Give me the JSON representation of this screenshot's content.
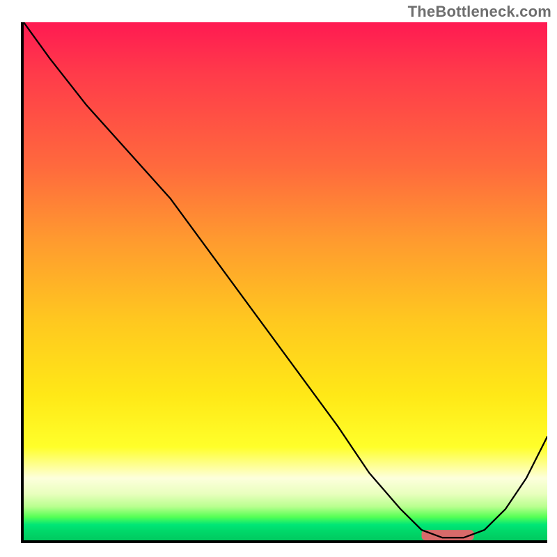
{
  "attribution": "TheBottleneck.com",
  "colors": {
    "gradient_top": "#ff1a52",
    "gradient_mid1": "#ff9a2f",
    "gradient_mid2": "#ffe817",
    "gradient_bottom": "#00c95f",
    "axis": "#000000",
    "curve": "#000000",
    "marker": "#d86a6a"
  },
  "chart_data": {
    "type": "line",
    "title": "",
    "xlabel": "",
    "ylabel": "",
    "xlim": [
      0,
      100
    ],
    "ylim": [
      0,
      100
    ],
    "grid": false,
    "series": [
      {
        "name": "curve",
        "x": [
          0,
          5,
          12,
          20,
          28,
          36,
          44,
          52,
          60,
          66,
          72,
          76,
          80,
          84,
          88,
          92,
          96,
          100
        ],
        "y": [
          100,
          93,
          84,
          75,
          66,
          55,
          44,
          33,
          22,
          13,
          6,
          2,
          0.5,
          0.5,
          2,
          6,
          12,
          20
        ]
      }
    ],
    "marker": {
      "x_start": 76,
      "x_end": 86,
      "y": 1,
      "height": 2
    },
    "legend": false,
    "annotations": []
  }
}
